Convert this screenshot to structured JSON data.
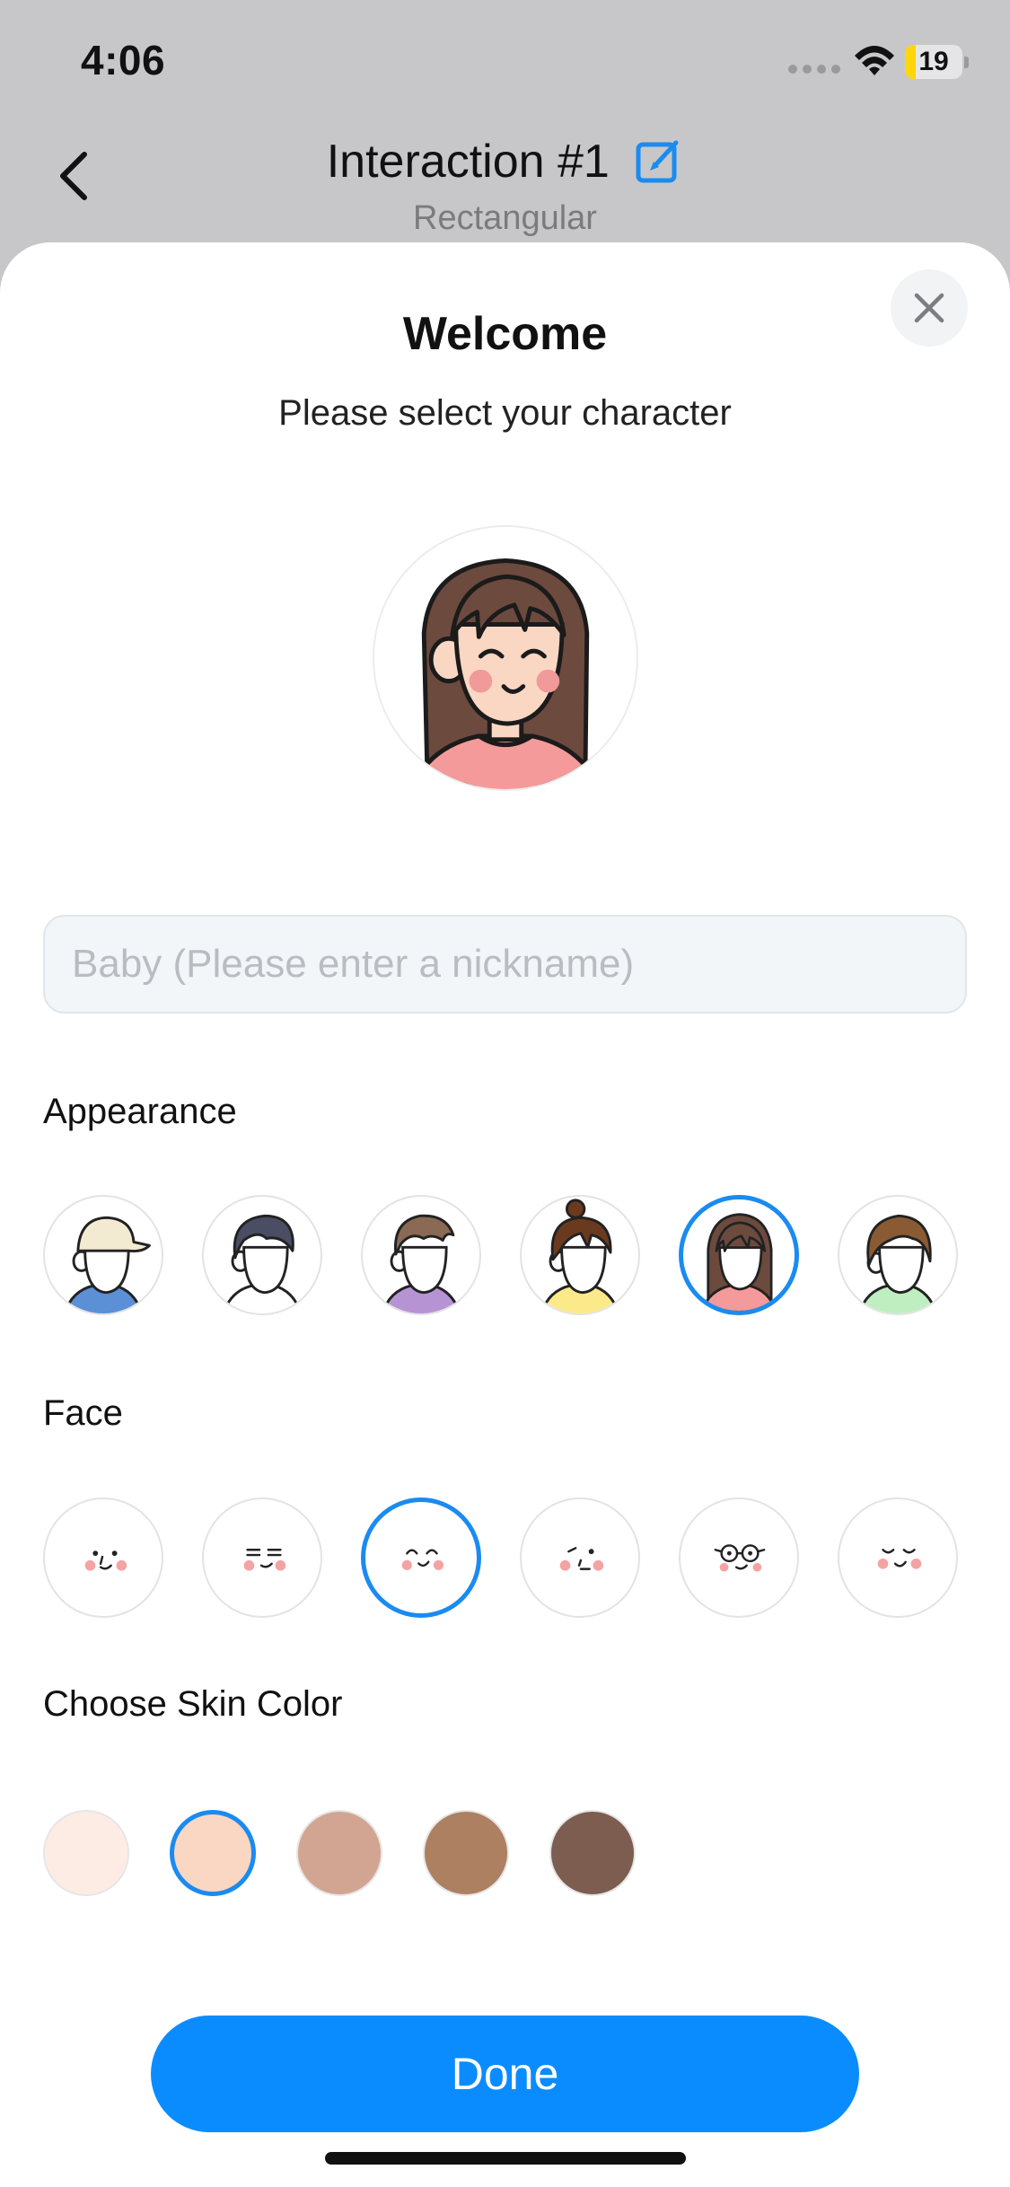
{
  "status_bar": {
    "time": "4:06",
    "battery": "19",
    "battery_level": 0.19
  },
  "nav": {
    "title": "Interaction #1",
    "subtitle": "Rectangular"
  },
  "sheet": {
    "title": "Welcome",
    "subtitle": "Please select your character",
    "nickname_placeholder": "Baby (Please enter a nickname)",
    "nickname_value": ""
  },
  "appearance": {
    "label": "Appearance",
    "selected_index": 4,
    "options": [
      {
        "icon": "boy-cap-avatar-icon",
        "hair": "#f3ead2",
        "shirt": "#5b8fd6"
      },
      {
        "icon": "boy-dark-hair-avatar-icon",
        "hair": "#4a4d63",
        "shirt": "#ffffff"
      },
      {
        "icon": "boy-brown-hair-avatar-icon",
        "hair": "#8a6a55",
        "shirt": "#b694d4"
      },
      {
        "icon": "girl-bun-avatar-icon",
        "hair": "#6b3a1e",
        "shirt": "#fbe98a"
      },
      {
        "icon": "girl-long-hair-avatar-icon",
        "hair": "#6d4a3e",
        "shirt": "#f59a9a"
      },
      {
        "icon": "boy-bob-hair-avatar-icon",
        "hair": "#8a5a33",
        "shirt": "#bfeec1"
      }
    ]
  },
  "face": {
    "label": "Face",
    "selected_index": 2,
    "options": [
      "face-calm-icon",
      "face-sleepy-icon",
      "face-happy-icon",
      "face-wink-icon",
      "face-glasses-icon",
      "face-content-icon"
    ]
  },
  "skin": {
    "label": "Choose Skin Color",
    "selected_index": 1,
    "colors": [
      "#fdece4",
      "#fad7c2",
      "#d2a592",
      "#ad8061",
      "#7c5d4f"
    ]
  },
  "done_label": "Done",
  "colors": {
    "accent": "#0a8cff",
    "selected_ring": "#1a8bf0",
    "sheet_bg": "#ffffff",
    "backdrop": "#c7c7c9"
  }
}
